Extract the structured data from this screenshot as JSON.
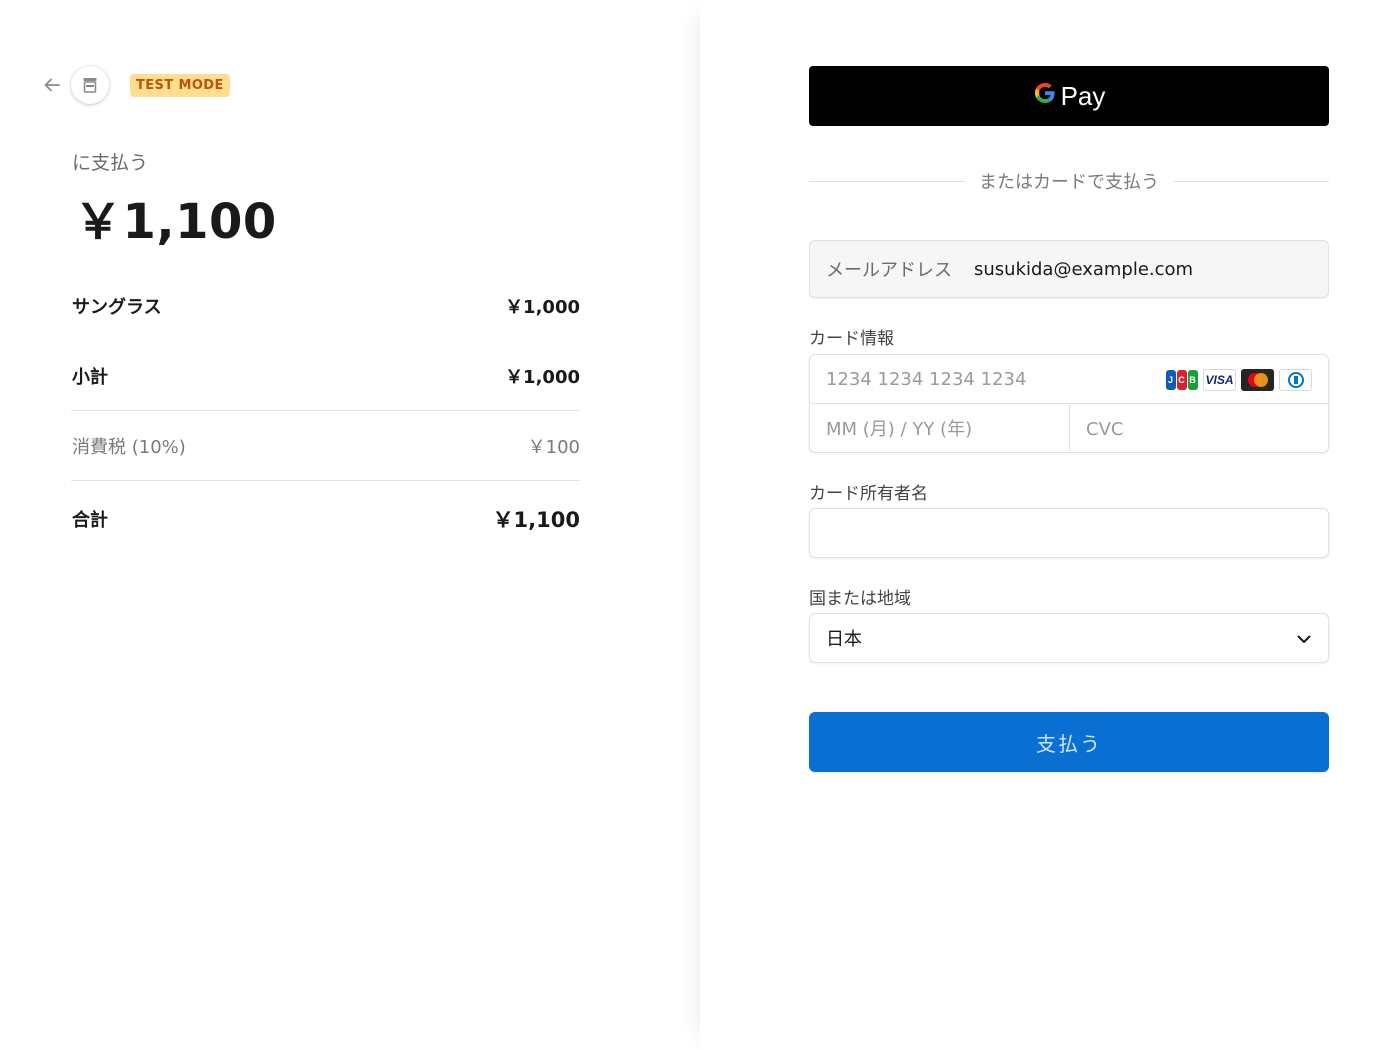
{
  "header": {
    "badge": "TEST MODE",
    "icons": {
      "back": "arrow-left-icon",
      "store": "store-icon"
    }
  },
  "summary": {
    "pay_to": "に支払う",
    "total": "￥1,100",
    "items": [
      {
        "label": "サングラス",
        "amount": "￥1,000"
      }
    ],
    "subtotal": {
      "label": "小計",
      "amount": "￥1,000"
    },
    "tax": {
      "label": "消費税 (10%)",
      "amount": "￥100"
    },
    "grand_total": {
      "label": "合計",
      "amount": "￥1,100"
    }
  },
  "payment": {
    "gpay": {
      "g": "G",
      "label": "Pay"
    },
    "or_card": "またはカードで支払う",
    "email": {
      "label": "メールアドレス",
      "value": "susukida@example.com"
    },
    "card": {
      "label": "カード情報",
      "number_placeholder": "1234 1234 1234 1234",
      "expiry_placeholder": "MM (月) / YY (年)",
      "cvc_placeholder": "CVC",
      "brands": [
        "JCB",
        "VISA",
        "Mastercard",
        "Diners Club"
      ]
    },
    "cardholder": {
      "label": "カード所有者名",
      "value": ""
    },
    "country": {
      "label": "国または地域",
      "value": "日本"
    },
    "submit": "支払う"
  },
  "colors": {
    "badge_bg": "#ffde92",
    "badge_text": "#bb5504",
    "pay_button": "#0a6fd3",
    "gpay_button": "#000000"
  }
}
